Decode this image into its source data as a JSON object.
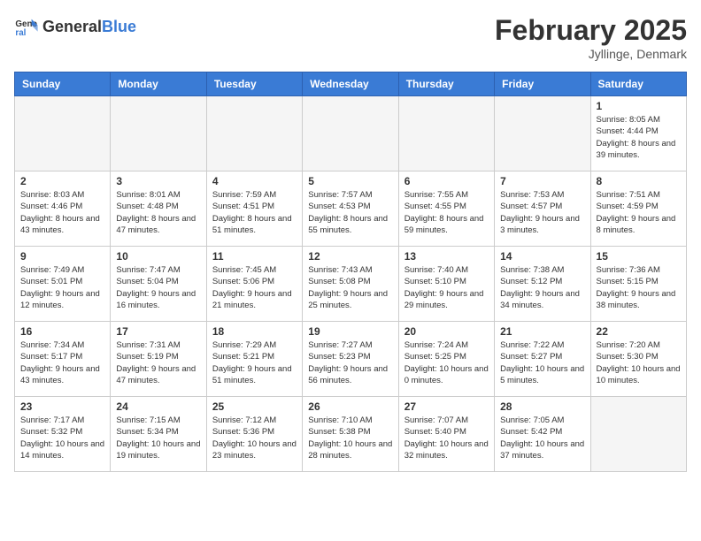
{
  "header": {
    "logo_general": "General",
    "logo_blue": "Blue",
    "month_title": "February 2025",
    "location": "Jyllinge, Denmark"
  },
  "weekdays": [
    "Sunday",
    "Monday",
    "Tuesday",
    "Wednesday",
    "Thursday",
    "Friday",
    "Saturday"
  ],
  "weeks": [
    [
      {
        "day": "",
        "info": ""
      },
      {
        "day": "",
        "info": ""
      },
      {
        "day": "",
        "info": ""
      },
      {
        "day": "",
        "info": ""
      },
      {
        "day": "",
        "info": ""
      },
      {
        "day": "",
        "info": ""
      },
      {
        "day": "1",
        "info": "Sunrise: 8:05 AM\nSunset: 4:44 PM\nDaylight: 8 hours and 39 minutes."
      }
    ],
    [
      {
        "day": "2",
        "info": "Sunrise: 8:03 AM\nSunset: 4:46 PM\nDaylight: 8 hours and 43 minutes."
      },
      {
        "day": "3",
        "info": "Sunrise: 8:01 AM\nSunset: 4:48 PM\nDaylight: 8 hours and 47 minutes."
      },
      {
        "day": "4",
        "info": "Sunrise: 7:59 AM\nSunset: 4:51 PM\nDaylight: 8 hours and 51 minutes."
      },
      {
        "day": "5",
        "info": "Sunrise: 7:57 AM\nSunset: 4:53 PM\nDaylight: 8 hours and 55 minutes."
      },
      {
        "day": "6",
        "info": "Sunrise: 7:55 AM\nSunset: 4:55 PM\nDaylight: 8 hours and 59 minutes."
      },
      {
        "day": "7",
        "info": "Sunrise: 7:53 AM\nSunset: 4:57 PM\nDaylight: 9 hours and 3 minutes."
      },
      {
        "day": "8",
        "info": "Sunrise: 7:51 AM\nSunset: 4:59 PM\nDaylight: 9 hours and 8 minutes."
      }
    ],
    [
      {
        "day": "9",
        "info": "Sunrise: 7:49 AM\nSunset: 5:01 PM\nDaylight: 9 hours and 12 minutes."
      },
      {
        "day": "10",
        "info": "Sunrise: 7:47 AM\nSunset: 5:04 PM\nDaylight: 9 hours and 16 minutes."
      },
      {
        "day": "11",
        "info": "Sunrise: 7:45 AM\nSunset: 5:06 PM\nDaylight: 9 hours and 21 minutes."
      },
      {
        "day": "12",
        "info": "Sunrise: 7:43 AM\nSunset: 5:08 PM\nDaylight: 9 hours and 25 minutes."
      },
      {
        "day": "13",
        "info": "Sunrise: 7:40 AM\nSunset: 5:10 PM\nDaylight: 9 hours and 29 minutes."
      },
      {
        "day": "14",
        "info": "Sunrise: 7:38 AM\nSunset: 5:12 PM\nDaylight: 9 hours and 34 minutes."
      },
      {
        "day": "15",
        "info": "Sunrise: 7:36 AM\nSunset: 5:15 PM\nDaylight: 9 hours and 38 minutes."
      }
    ],
    [
      {
        "day": "16",
        "info": "Sunrise: 7:34 AM\nSunset: 5:17 PM\nDaylight: 9 hours and 43 minutes."
      },
      {
        "day": "17",
        "info": "Sunrise: 7:31 AM\nSunset: 5:19 PM\nDaylight: 9 hours and 47 minutes."
      },
      {
        "day": "18",
        "info": "Sunrise: 7:29 AM\nSunset: 5:21 PM\nDaylight: 9 hours and 51 minutes."
      },
      {
        "day": "19",
        "info": "Sunrise: 7:27 AM\nSunset: 5:23 PM\nDaylight: 9 hours and 56 minutes."
      },
      {
        "day": "20",
        "info": "Sunrise: 7:24 AM\nSunset: 5:25 PM\nDaylight: 10 hours and 0 minutes."
      },
      {
        "day": "21",
        "info": "Sunrise: 7:22 AM\nSunset: 5:27 PM\nDaylight: 10 hours and 5 minutes."
      },
      {
        "day": "22",
        "info": "Sunrise: 7:20 AM\nSunset: 5:30 PM\nDaylight: 10 hours and 10 minutes."
      }
    ],
    [
      {
        "day": "23",
        "info": "Sunrise: 7:17 AM\nSunset: 5:32 PM\nDaylight: 10 hours and 14 minutes."
      },
      {
        "day": "24",
        "info": "Sunrise: 7:15 AM\nSunset: 5:34 PM\nDaylight: 10 hours and 19 minutes."
      },
      {
        "day": "25",
        "info": "Sunrise: 7:12 AM\nSunset: 5:36 PM\nDaylight: 10 hours and 23 minutes."
      },
      {
        "day": "26",
        "info": "Sunrise: 7:10 AM\nSunset: 5:38 PM\nDaylight: 10 hours and 28 minutes."
      },
      {
        "day": "27",
        "info": "Sunrise: 7:07 AM\nSunset: 5:40 PM\nDaylight: 10 hours and 32 minutes."
      },
      {
        "day": "28",
        "info": "Sunrise: 7:05 AM\nSunset: 5:42 PM\nDaylight: 10 hours and 37 minutes."
      },
      {
        "day": "",
        "info": ""
      }
    ]
  ]
}
